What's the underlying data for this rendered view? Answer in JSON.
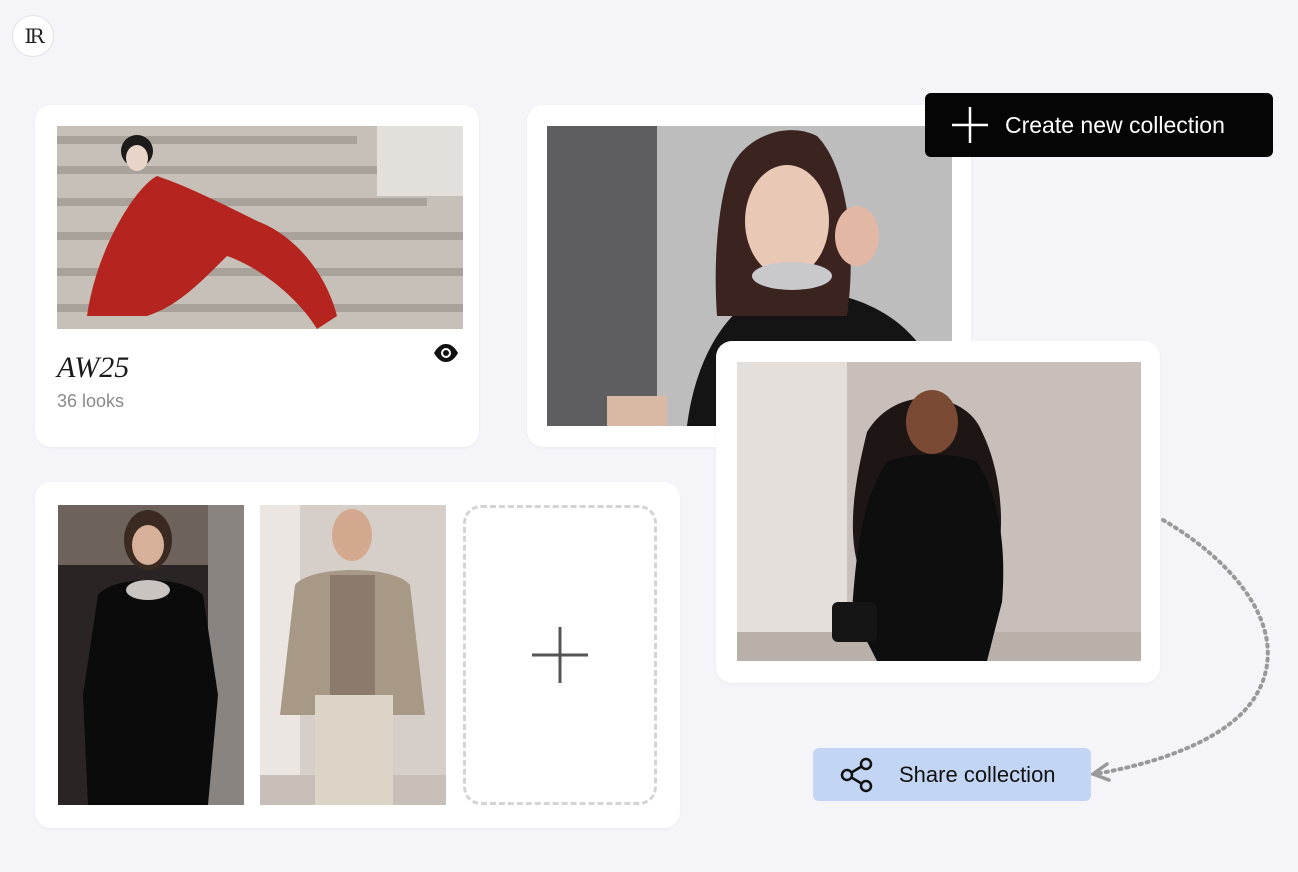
{
  "brand": {
    "logo_text": "IR"
  },
  "toolbar": {
    "create_label": "Create new collection",
    "create_icon": "plus-icon"
  },
  "collection": {
    "title": "AW25",
    "count": "36 looks",
    "view_icon": "eye-icon"
  },
  "share": {
    "label": "Share collection",
    "icon": "share-icon"
  },
  "add_look": {
    "icon": "plus-icon"
  },
  "colors": {
    "background": "#f4f4f9",
    "create_button": "#050505",
    "share_button": "#c3d5f4",
    "card": "#ffffff"
  }
}
